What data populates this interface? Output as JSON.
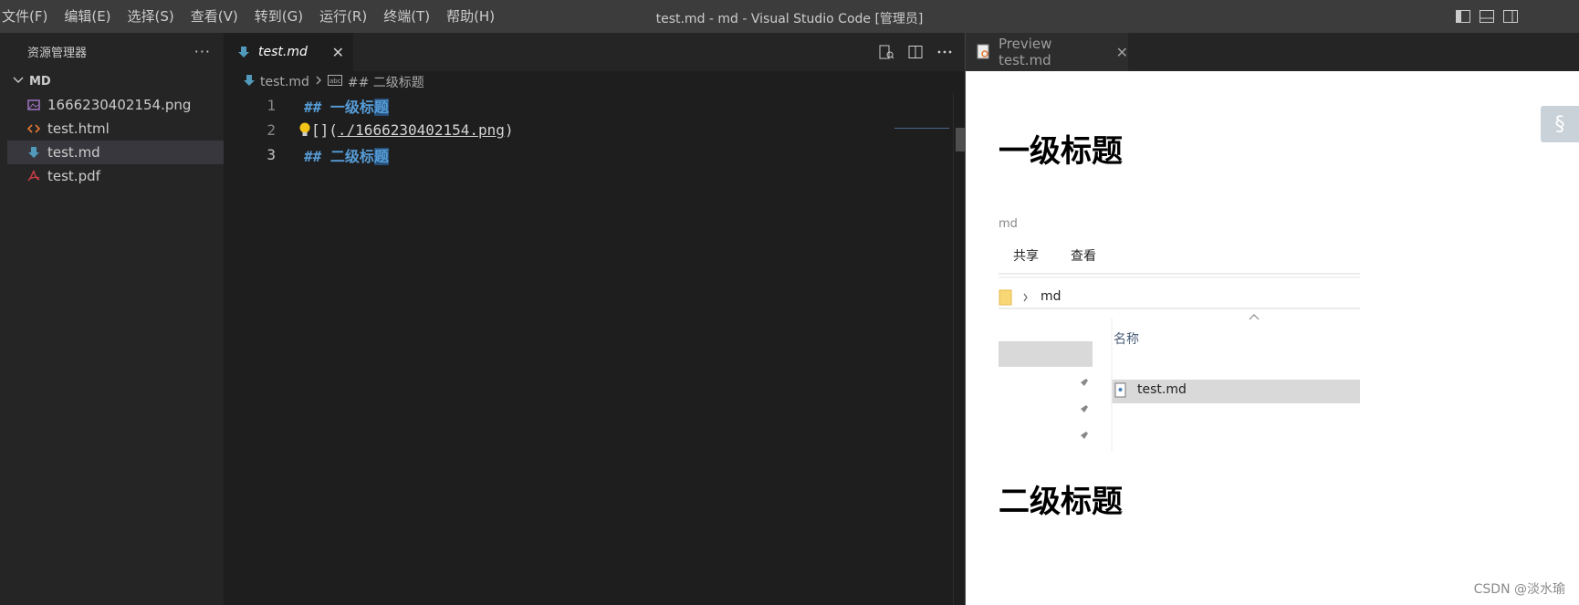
{
  "menu": [
    "文件(F)",
    "编辑(E)",
    "选择(S)",
    "查看(V)",
    "转到(G)",
    "运行(R)",
    "终端(T)",
    "帮助(H)"
  ],
  "window_title": "test.md - md - Visual Studio Code [管理员]",
  "sidebar": {
    "title": "资源管理器",
    "more": "···",
    "folder": "MD",
    "files": [
      {
        "name": "1666230402154.png",
        "icon": "image-file-icon",
        "color": "#a074c4"
      },
      {
        "name": "test.html",
        "icon": "html-file-icon",
        "color": "#e37933"
      },
      {
        "name": "test.md",
        "icon": "markdown-file-icon",
        "color": "#519aba"
      },
      {
        "name": "test.pdf",
        "icon": "pdf-file-icon",
        "color": "#cc3e44"
      }
    ]
  },
  "editor": {
    "tab_label": "test.md",
    "breadcrumb_file": "test.md",
    "breadcrumb_symbol": "## 二级标题",
    "lines": [
      {
        "num": "1",
        "hash": "##",
        "text": "一级标",
        "hl": "题"
      },
      {
        "num": "2",
        "prefix": "[",
        "link_open": "](",
        "link": "./1666230402154.png",
        "link_close": ")"
      },
      {
        "num": "3",
        "hash": "##",
        "text": "二级标",
        "hl": "题"
      }
    ]
  },
  "preview": {
    "tab_label": "Preview test.md",
    "heading1": "一级标题",
    "heading2": "二级标题",
    "section_button": "§",
    "embedded": {
      "title": "md",
      "ribbon": [
        "共享",
        "查看"
      ],
      "path": "md",
      "column": "名称",
      "file": "test.md"
    }
  },
  "watermark": "CSDN @淡水瑜"
}
